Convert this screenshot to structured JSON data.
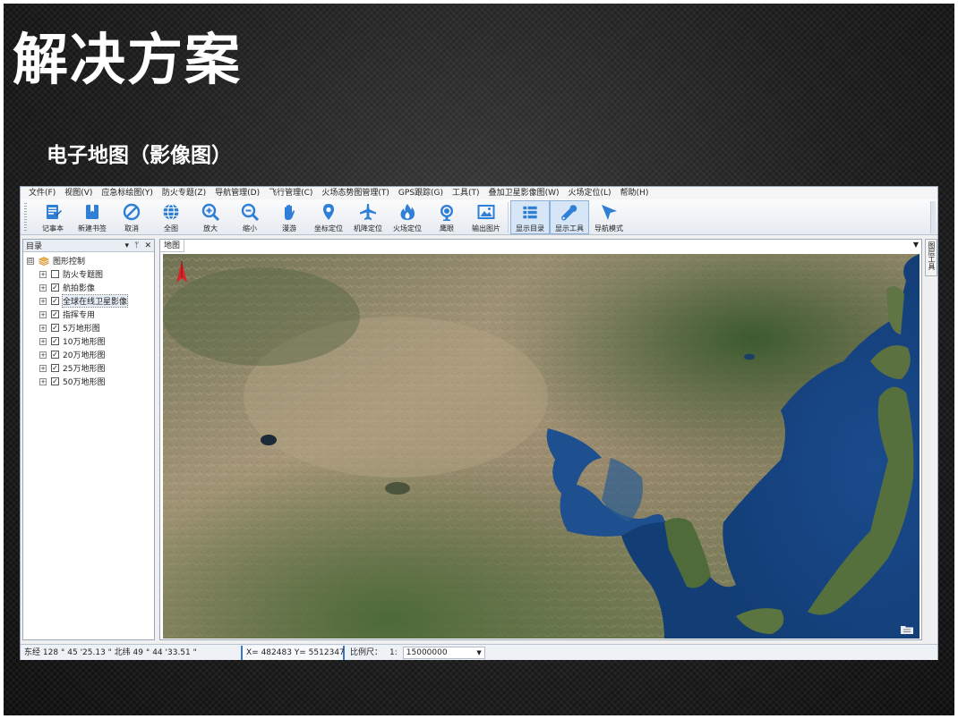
{
  "slide": {
    "title": "解决方案",
    "subtitle": "电子地图（影像图）"
  },
  "menubar": {
    "items": [
      "文件(F)",
      "视图(V)",
      "应急标绘图(Y)",
      "防火专题(Z)",
      "导航管理(D)",
      "飞行管理(C)",
      "火场态势图管理(T)",
      "GPS跟踪(G)",
      "工具(T)",
      "叠加卫星影像图(W)",
      "火场定位(L)",
      "帮助(H)"
    ]
  },
  "toolbar": {
    "buttons": [
      {
        "label": "记事本",
        "icon": "notepad-icon"
      },
      {
        "label": "新建书签",
        "icon": "bookmark-icon"
      },
      {
        "label": "取消",
        "icon": "cancel-icon"
      },
      {
        "label": "全图",
        "icon": "globe-icon"
      },
      {
        "label": "放大",
        "icon": "zoom-in-icon"
      },
      {
        "label": "缩小",
        "icon": "zoom-out-icon"
      },
      {
        "label": "漫游",
        "icon": "hand-icon"
      },
      {
        "label": "坐标定位",
        "icon": "pin-icon"
      },
      {
        "label": "机降定位",
        "icon": "plane-icon"
      },
      {
        "label": "火场定位",
        "icon": "fire-icon"
      },
      {
        "label": "鹰眼",
        "icon": "eagle-eye-icon"
      },
      {
        "label": "输出图片",
        "icon": "picture-icon"
      },
      {
        "label": "显示目录",
        "icon": "list-icon"
      },
      {
        "label": "显示工具",
        "icon": "wrench-icon"
      },
      {
        "label": "导航模式",
        "icon": "navigate-icon"
      }
    ]
  },
  "catalog": {
    "title": "目录",
    "controls": {
      "dropdown": "▾",
      "pin": "ᛘ",
      "close": "✕"
    },
    "root": {
      "expander": "⊟",
      "label": "图形控制"
    },
    "layers": [
      {
        "label": "防火专题图",
        "checked": false,
        "mark": ""
      },
      {
        "label": "航拍影像",
        "checked": true,
        "mark": "✓"
      },
      {
        "label": "全球在线卫星影像",
        "checked": true,
        "mark": "✓"
      },
      {
        "label": "指挥专用",
        "checked": true,
        "mark": "✓"
      },
      {
        "label": "5万地形图",
        "checked": true,
        "mark": "✓"
      },
      {
        "label": "10万地形图",
        "checked": true,
        "mark": "✓"
      },
      {
        "label": "20万地形图",
        "checked": true,
        "mark": "✓"
      },
      {
        "label": "25万地形图",
        "checked": true,
        "mark": "✓"
      },
      {
        "label": "50万地形图",
        "checked": true,
        "mark": "✓"
      }
    ],
    "expander_plus": "+"
  },
  "map": {
    "tab": "地图",
    "tab_menu": "▼"
  },
  "side_strip": {
    "label": "图层工具"
  },
  "statusbar": {
    "coords": "东经 128 °  45 '25.13 \"  北纬 49 °  44 '33.51 \"",
    "xy": "X= 482483  Y= 5512347",
    "scale_label": "比例尺：",
    "scale_prefix": "1:",
    "scale_value": "15000000",
    "scale_dropdown": "▼"
  },
  "colors": {
    "toolbar_icon": "#2f7fd6",
    "sea": "#1e4f8e",
    "land_dry": "#a49170",
    "land_green": "#4e6b3a"
  }
}
